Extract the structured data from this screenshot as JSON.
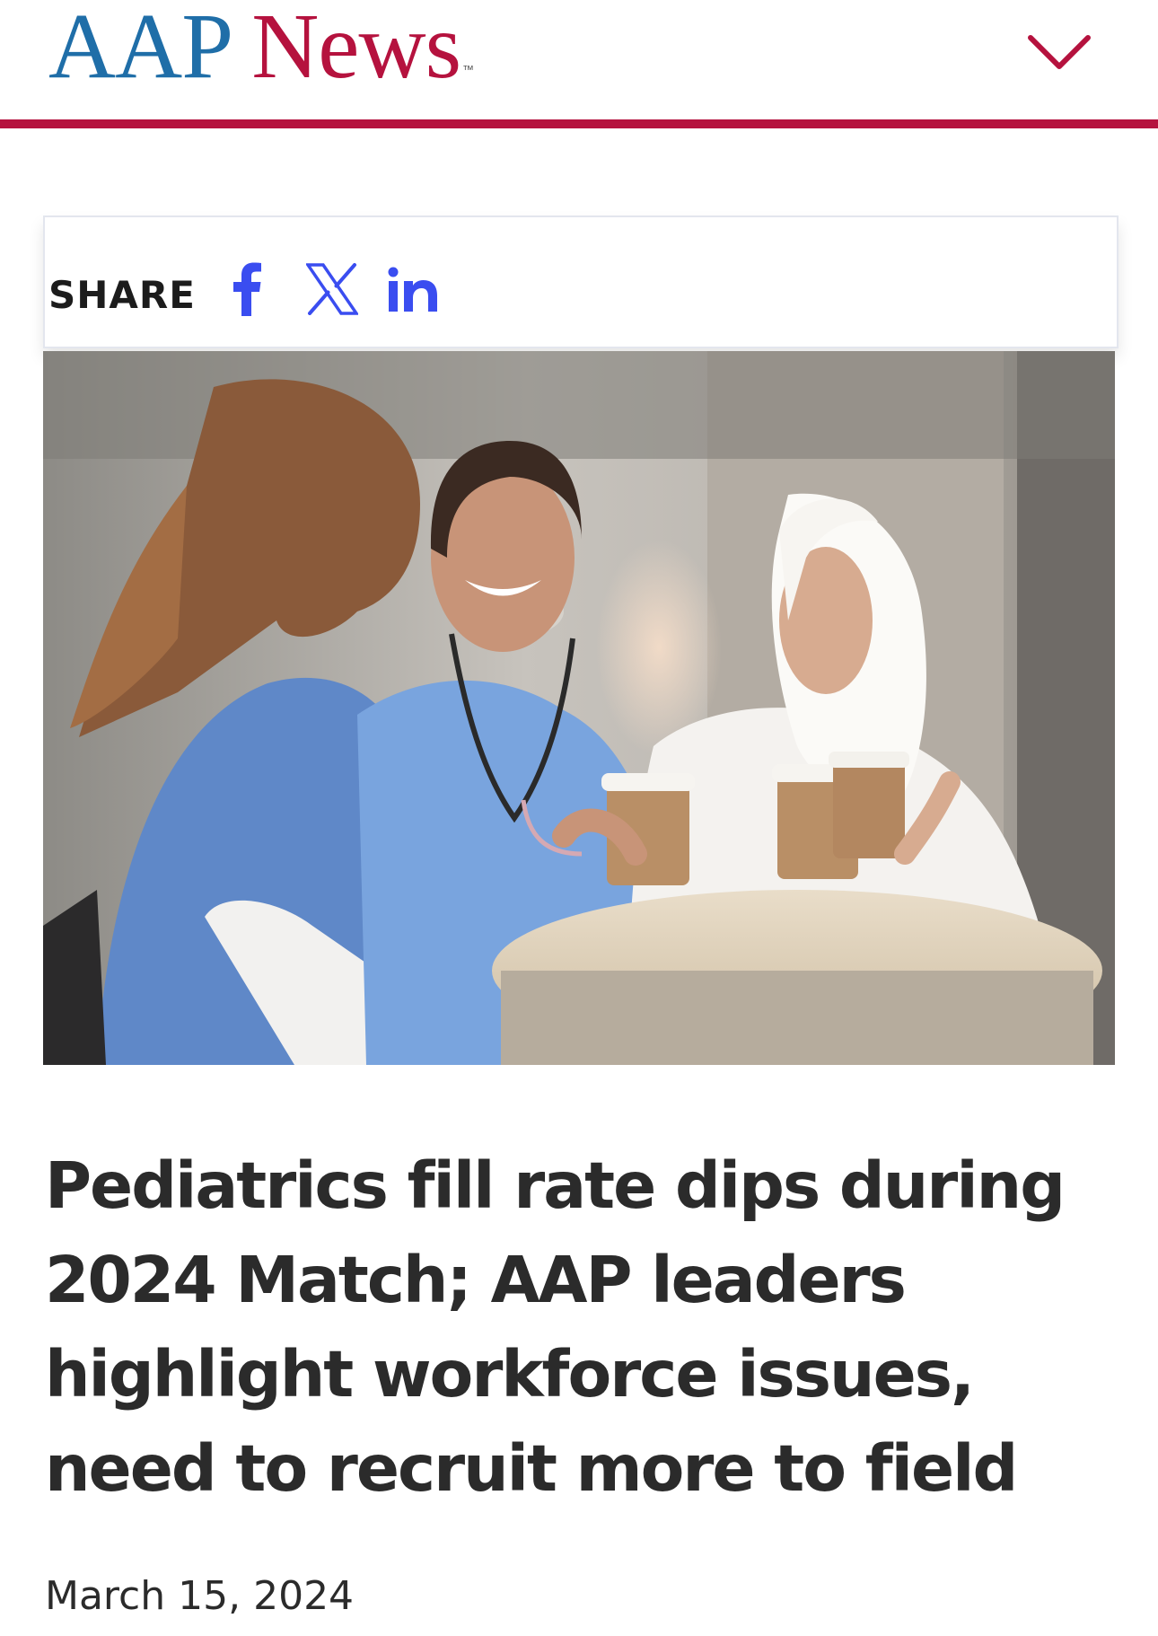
{
  "header": {
    "logo_aap": "AAP",
    "logo_news": "News",
    "logo_tm": "™",
    "menu_icon": "chevron-down-icon",
    "brand_blue": "#1f6ea8",
    "brand_red": "#b5123e"
  },
  "share": {
    "label": "SHARE",
    "icons": [
      "facebook-icon",
      "x-icon",
      "linkedin-icon"
    ],
    "icon_color": "#3a4df0"
  },
  "article": {
    "image_alt": "Three healthcare workers in scrubs and a white coat chatting over coffee at a table",
    "headline": "Pediatrics fill rate dips during 2024 Match; AAP leaders highlight workforce issues, need to recruit more to field",
    "date": "March 15, 2024"
  }
}
